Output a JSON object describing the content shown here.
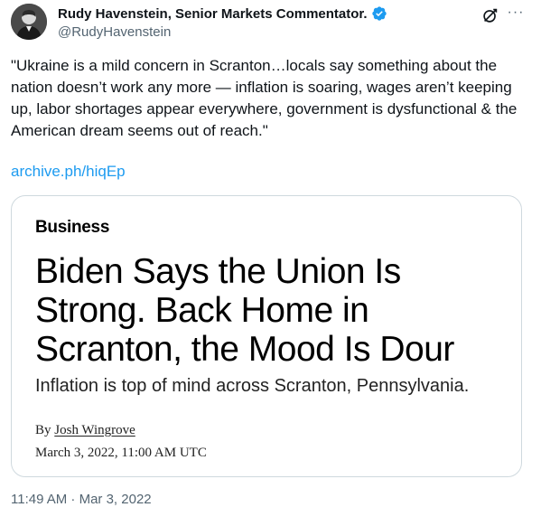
{
  "tweet": {
    "author_name": "Rudy Havenstein, Senior Markets Commentator.",
    "author_handle": "@RudyHavenstein",
    "text": "\"Ukraine is a mild concern in Scranton…locals say something about the nation doesn’t work any more — inflation is soaring, wages aren’t keeping up, labor shortages appear everywhere, government is dysfunctional & the American dream seems out of reach.\"",
    "link": "archive.ph/hiqEp",
    "more_label": "···",
    "timestamp": "11:49 AM · Mar 3, 2022"
  },
  "card": {
    "section": "Business",
    "headline": "Biden Says the Union Is Strong. Back Home in Scranton, the Mood Is Dour",
    "subheadline": "Inflation is top of mind across Scranton, Pennsylvania.",
    "byline_prefix": "By ",
    "author": "Josh Wingrove",
    "date": "March 3, 2022, 11:00 AM UTC"
  },
  "colors": {
    "verified": "#1d9bf0",
    "link": "#1d9bf0",
    "secondary_text": "#536471",
    "border": "#cfd9de"
  },
  "icons": {
    "verified": "verified-badge-icon",
    "grok": "grok-icon",
    "more": "more-options-icon"
  }
}
